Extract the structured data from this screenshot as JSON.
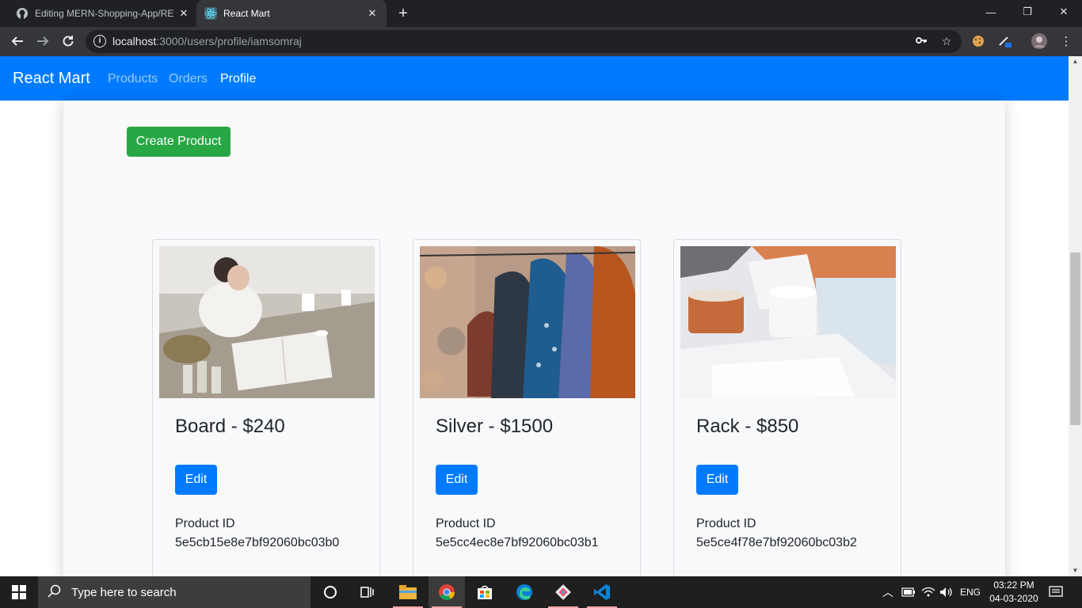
{
  "browser": {
    "tabs": [
      {
        "title": "Editing MERN-Shopping-App/RE",
        "icon": "github-icon"
      },
      {
        "title": "React Mart",
        "icon": "react-icon"
      }
    ],
    "new_tab_icon": "plus-icon",
    "url_host": "localhost",
    "url_path": ":3000/users/profile/iamsomraj"
  },
  "app": {
    "brand": "React Mart",
    "nav": [
      {
        "label": "Products",
        "active": false
      },
      {
        "label": "Orders",
        "active": false
      },
      {
        "label": "Profile",
        "active": true
      }
    ],
    "create_button": "Create Product",
    "product_id_label": "Product ID",
    "edit_label": "Edit",
    "products": [
      {
        "title": "Board - $240",
        "id": "5e5cb15e8e7bf92060bc03b0"
      },
      {
        "title": "Silver - $1500",
        "id": "5e5cc4ec8e7bf92060bc03b1"
      },
      {
        "title": "Rack - $850",
        "id": "5e5ce4f78e7bf92060bc03b2"
      }
    ]
  },
  "colors": {
    "navbar": "#007bff",
    "create_button": "#28a745",
    "edit_button": "#007bff",
    "container": "#f8f9fa"
  },
  "taskbar": {
    "search_placeholder": "Type here to search",
    "language": "ENG",
    "time": "03:22 PM",
    "date": "04-03-2020"
  }
}
